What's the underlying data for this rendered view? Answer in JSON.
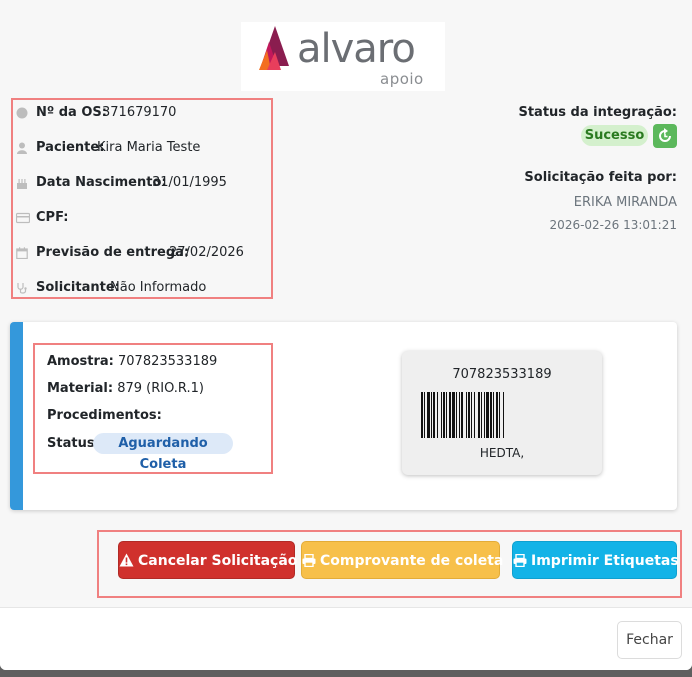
{
  "logo": {
    "text": "alvaro",
    "sub": "apoio"
  },
  "order": {
    "os_label": "Nº da OS:",
    "os_value": "371679170",
    "patient_label": "Paciente:",
    "patient_value": "Kira Maria Teste",
    "birth_label": "Data Nascimento:",
    "birth_value": "31/01/1995",
    "cpf_label": "CPF:",
    "cpf_value": "",
    "delivery_label": "Previsão de entrega:",
    "delivery_value": "27/02/2026",
    "requester_label": "Solicitante:",
    "requester_value": "Não Informado"
  },
  "integration": {
    "title": "Status da integração:",
    "status": "Sucesso",
    "status_color": "#2a7a20",
    "requested_by_label": "Solicitação feita por:",
    "requested_by": "ERIKA MIRANDA",
    "requested_at": "2026-02-26 13:01:21"
  },
  "sample": {
    "amostra_label": "Amostra:",
    "amostra_value": "707823533189",
    "material_label": "Material:",
    "material_value": "879 (RIO.R.1)",
    "procedures_label": "Procedimentos:",
    "status_label": "Status:",
    "status_value": "Aguardando Coleta"
  },
  "barcode_label": {
    "code": "707823533189",
    "name": "HEDTA,"
  },
  "actions": {
    "cancel": "Cancelar Solicitação",
    "receipt": "Comprovante de coleta",
    "print": "Imprimir Etiquetas",
    "close": "Fechar"
  },
  "icons": {
    "os": "circle-icon",
    "patient": "user-icon",
    "birth": "cake-icon",
    "cpf": "card-icon",
    "delivery": "calendar-icon",
    "requester": "stethoscope-icon",
    "sync": "sync-icon",
    "cancel": "warning-icon",
    "receipt": "printer-icon",
    "print": "printer-icon"
  },
  "colors": {
    "accent_stripe": "#3498db",
    "cancel": "#d0312d",
    "receipt": "#f7c04a",
    "print": "#13b3e7",
    "success_badge": "#d4f0cd"
  }
}
